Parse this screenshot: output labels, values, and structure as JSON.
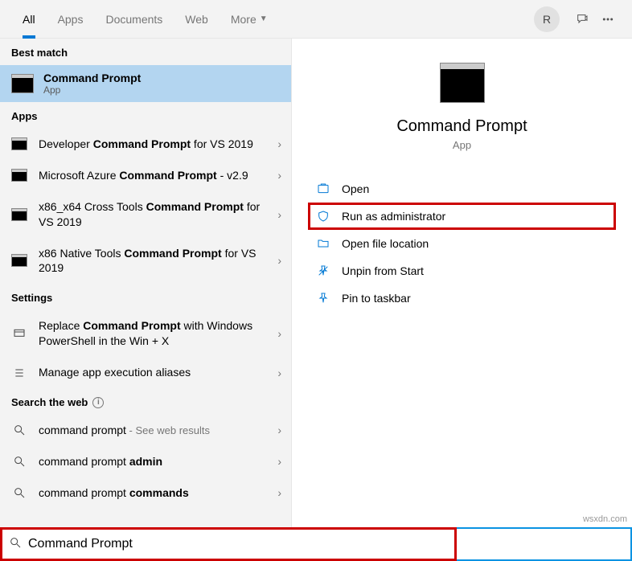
{
  "tabs": {
    "all": "All",
    "apps": "Apps",
    "documents": "Documents",
    "web": "Web",
    "more": "More"
  },
  "avatar": "R",
  "sections": {
    "best_match": "Best match",
    "apps": "Apps",
    "settings": "Settings",
    "web": "Search the web"
  },
  "best_match": {
    "title": "Command Prompt",
    "sub": "App"
  },
  "apps_items": [
    {
      "pre": "Developer ",
      "bold": "Command Prompt",
      "post": " for VS 2019"
    },
    {
      "pre": "Microsoft Azure ",
      "bold": "Command Prompt",
      "post": " - v2.9"
    },
    {
      "pre": "x86_x64 Cross Tools ",
      "bold": "Command Prompt",
      "post": " for VS 2019"
    },
    {
      "pre": "x86 Native Tools ",
      "bold": "Command Prompt",
      "post": " for VS 2019"
    }
  ],
  "settings_items": [
    {
      "pre": "Replace ",
      "bold": "Command Prompt",
      "post": " with Windows PowerShell in the Win + X"
    },
    {
      "pre": "Manage app execution aliases",
      "bold": "",
      "post": ""
    }
  ],
  "web_items": [
    {
      "text": "command prompt",
      "hint": " - See web results"
    },
    {
      "text_pre": "command prompt ",
      "text_bold": "admin"
    },
    {
      "text_pre": "command prompt ",
      "text_bold": "commands"
    }
  ],
  "preview": {
    "title": "Command Prompt",
    "sub": "App"
  },
  "actions": {
    "open": "Open",
    "run_admin": "Run as administrator",
    "open_loc": "Open file location",
    "unpin_start": "Unpin from Start",
    "pin_taskbar": "Pin to taskbar"
  },
  "search": {
    "value": "Command Prompt"
  },
  "watermark": "wsxdn.com"
}
